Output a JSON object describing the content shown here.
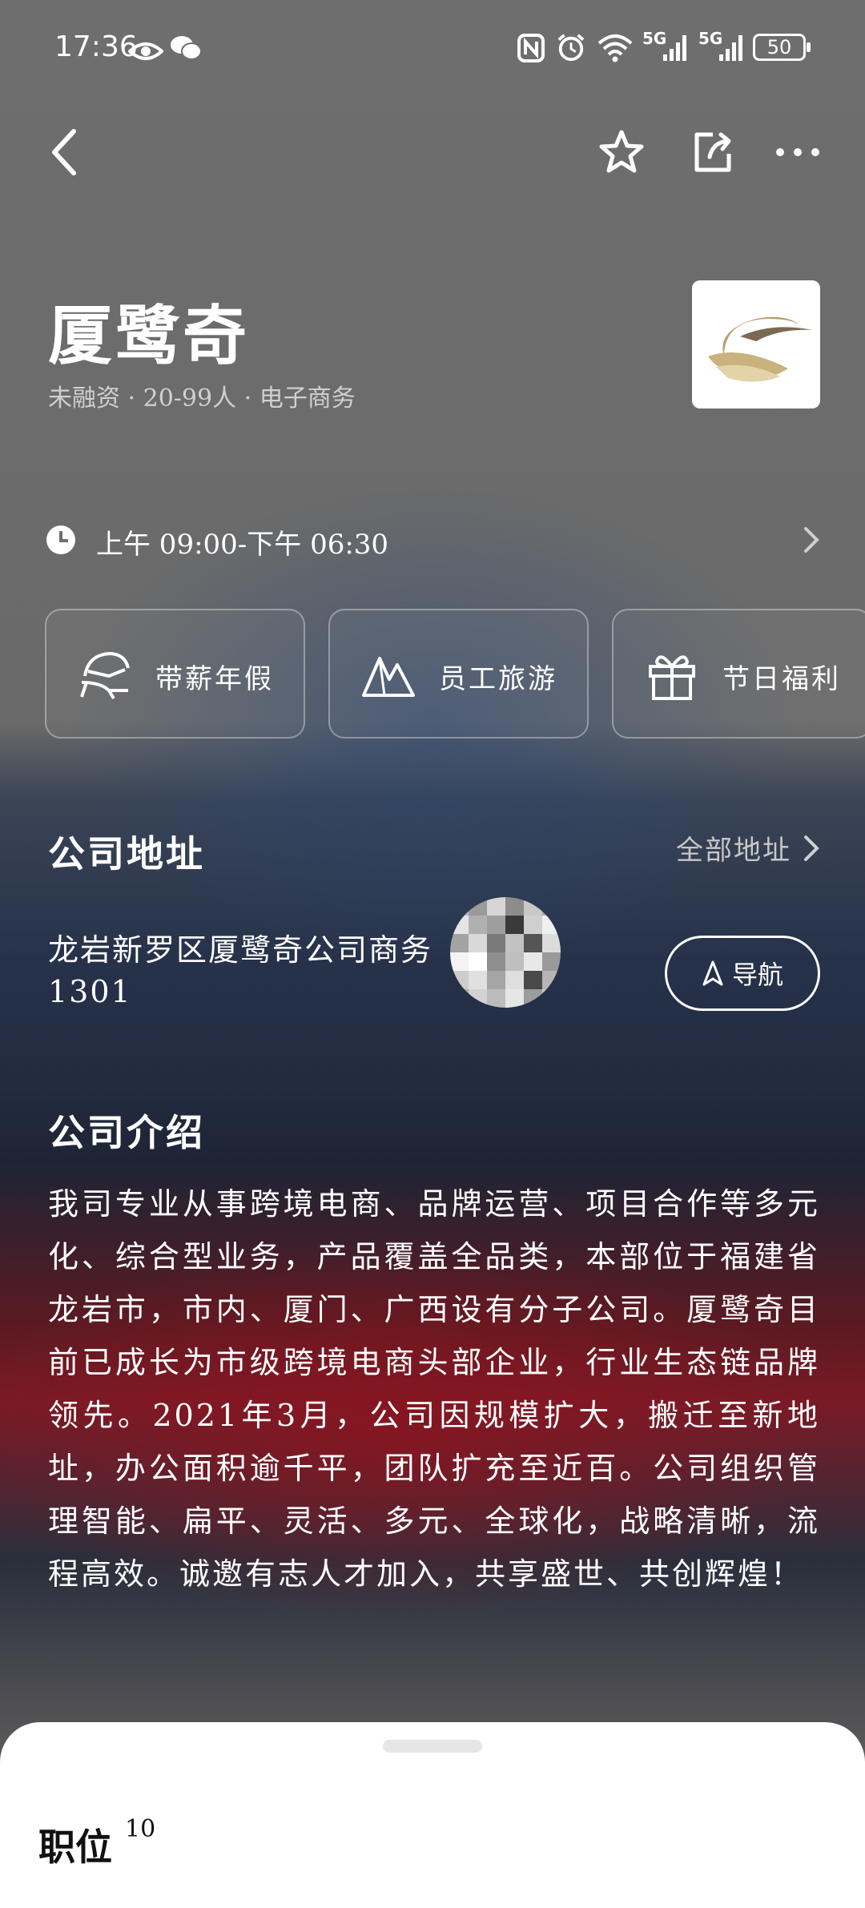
{
  "status_bar": {
    "time": "17:36",
    "signal_1": "5G",
    "signal_2": "5G",
    "battery": "50"
  },
  "nav": {
    "back_icon": "chevron-left-icon",
    "favorite_icon": "star-icon",
    "share_icon": "share-icon",
    "more_icon": "more-icon"
  },
  "company": {
    "name": "厦鹭奇",
    "meta": "未融资 · 20-99人 · 电子商务"
  },
  "hours": {
    "text": "上午 09:00-下午 06:30"
  },
  "benefits": [
    {
      "label": "带薪年假",
      "icon": "lounge-chair-icon"
    },
    {
      "label": "员工旅游",
      "icon": "mountain-icon"
    },
    {
      "label": "节日福利",
      "icon": "gift-icon"
    }
  ],
  "address": {
    "title": "公司地址",
    "all_label": "全部地址",
    "text": "龙岩新罗区厦鹭奇公司商务　　栋1301",
    "nav_label": "导航"
  },
  "intro": {
    "title": "公司介绍",
    "text": "我司专业从事跨境电商、品牌运营、项目合作等多元化、综合型业务，产品覆盖全品类，本部位于福建省龙岩市，市内、厦门、广西设有分子公司。厦鹭奇目前已成长为市级跨境电商头部企业，行业生态链品牌领先。2021年3月，公司因规模扩大，搬迁至新地址，办公面积逾千平，团队扩充至近百。公司组织管理智能、扁平、灵活、多元、全球化，战略清晰，流程高效。诚邀有志人才加入，共享盛世、共创辉煌！"
  },
  "jobs": {
    "title": "职位",
    "count": "10"
  }
}
